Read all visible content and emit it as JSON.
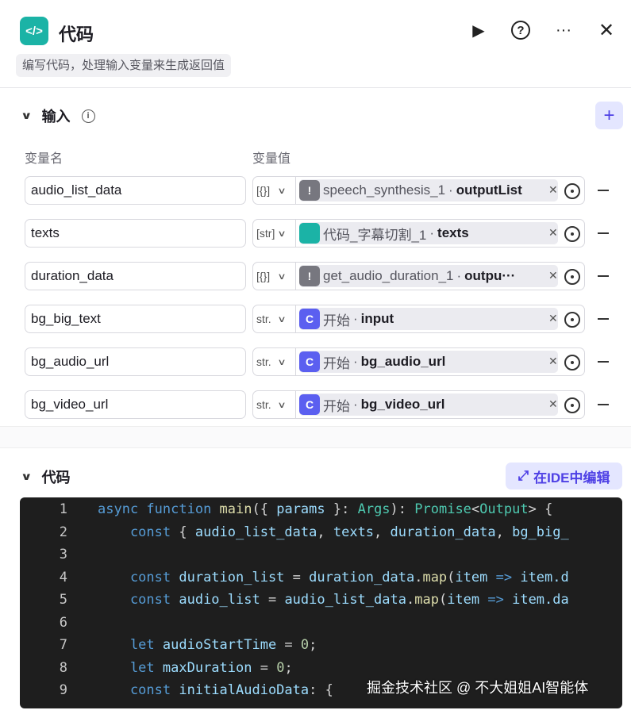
{
  "header": {
    "icon": "code-icon",
    "title": "代码",
    "description": "编写代码，处理输入变量来生成返回值",
    "actions": [
      "play-icon",
      "help-icon",
      "more-icon",
      "close-icon"
    ]
  },
  "inputs": {
    "title": "输入",
    "col_name": "变量名",
    "col_value": "变量值",
    "rows": [
      {
        "name": "audio_list_data",
        "type": "[{}]",
        "node": "speech_synthesis_1",
        "field": "outputList",
        "icon": "!",
        "color": "#77777f"
      },
      {
        "name": "texts",
        "type": "[str]",
        "node": "代码_字幕切割_1",
        "field": "texts",
        "icon": "</>",
        "color": "#1bb3a6"
      },
      {
        "name": "duration_data",
        "type": "[{}]",
        "node": "get_audio_duration_1",
        "field": "outpu···",
        "icon": "!",
        "color": "#77777f"
      },
      {
        "name": "bg_big_text",
        "type": "str.",
        "node": "开始",
        "field": "input",
        "icon": "C",
        "color": "#5b5ff0"
      },
      {
        "name": "bg_audio_url",
        "type": "str.",
        "node": "开始",
        "field": "bg_audio_url",
        "icon": "C",
        "color": "#5b5ff0"
      },
      {
        "name": "bg_video_url",
        "type": "str.",
        "node": "开始",
        "field": "bg_video_url",
        "icon": "C",
        "color": "#5b5ff0"
      }
    ]
  },
  "code": {
    "title": "代码",
    "ide_label": "在IDE中编辑",
    "lines": [
      [
        [
          "async ",
          "kw"
        ],
        [
          "function ",
          "kw"
        ],
        [
          "main",
          "fn"
        ],
        [
          "({ ",
          "pu"
        ],
        [
          "params",
          "vr"
        ],
        [
          " }: ",
          "pu"
        ],
        [
          "Args",
          "ty"
        ],
        [
          "): ",
          "pu"
        ],
        [
          "Promise",
          "ty"
        ],
        [
          "<",
          "pu"
        ],
        [
          "Output",
          "ty"
        ],
        [
          "> {",
          "pu"
        ]
      ],
      [
        [
          "    const ",
          "kw"
        ],
        [
          "{ ",
          "pu"
        ],
        [
          "audio_list_data",
          "vr"
        ],
        [
          ", ",
          "pu"
        ],
        [
          "texts",
          "vr"
        ],
        [
          ", ",
          "pu"
        ],
        [
          "duration_data",
          "vr"
        ],
        [
          ", ",
          "pu"
        ],
        [
          "bg_big_",
          "vr"
        ]
      ],
      [],
      [
        [
          "    const ",
          "kw"
        ],
        [
          "duration_list",
          "vr"
        ],
        [
          " = ",
          "pu"
        ],
        [
          "duration_data",
          "vr"
        ],
        [
          ".",
          "pu"
        ],
        [
          "map",
          "fn"
        ],
        [
          "(",
          "pu"
        ],
        [
          "item",
          "vr"
        ],
        [
          " => ",
          "kw"
        ],
        [
          "item.d",
          "vr"
        ]
      ],
      [
        [
          "    const ",
          "kw"
        ],
        [
          "audio_list",
          "vr"
        ],
        [
          " = ",
          "pu"
        ],
        [
          "audio_list_data",
          "vr"
        ],
        [
          ".",
          "pu"
        ],
        [
          "map",
          "fn"
        ],
        [
          "(",
          "pu"
        ],
        [
          "item",
          "vr"
        ],
        [
          " => ",
          "kw"
        ],
        [
          "item.da",
          "vr"
        ]
      ],
      [],
      [
        [
          "    let ",
          "kw"
        ],
        [
          "audioStartTime",
          "vr"
        ],
        [
          " = ",
          "pu"
        ],
        [
          "0",
          "nu"
        ],
        [
          ";",
          "pu"
        ]
      ],
      [
        [
          "    let ",
          "kw"
        ],
        [
          "maxDuration",
          "vr"
        ],
        [
          " = ",
          "pu"
        ],
        [
          "0",
          "nu"
        ],
        [
          ";",
          "pu"
        ]
      ],
      [
        [
          "    const ",
          "kw"
        ],
        [
          "initialAudioData",
          "vr"
        ],
        [
          ": {",
          "pu"
        ]
      ]
    ]
  },
  "watermark": "掘金技术社区 @ 不大姐姐AI智能体"
}
